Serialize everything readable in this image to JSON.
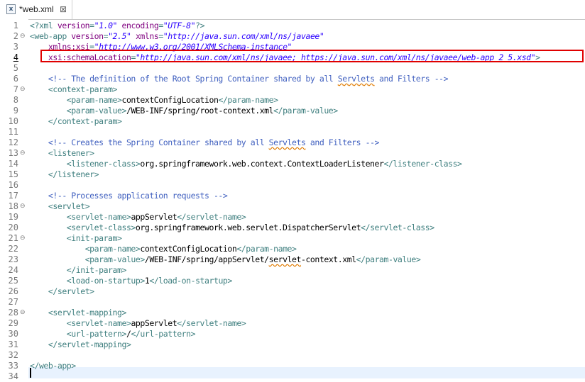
{
  "tab": {
    "icon": "xml-file-icon",
    "title": "*web.xml",
    "close": "⊠"
  },
  "lines": [
    {
      "n": "1",
      "fold": "",
      "parts": [
        [
          "t",
          "<?xml "
        ],
        [
          "a",
          "version"
        ],
        [
          "t",
          "="
        ],
        [
          "v",
          "\"1.0\""
        ],
        [
          "t",
          " "
        ],
        [
          "a",
          "encoding"
        ],
        [
          "t",
          "="
        ],
        [
          "v",
          "\"UTF-8\""
        ],
        [
          "t",
          "?>"
        ]
      ]
    },
    {
      "n": "2",
      "fold": "⊖",
      "parts": [
        [
          "t",
          "<web-app "
        ],
        [
          "a",
          "version"
        ],
        [
          "t",
          "="
        ],
        [
          "v",
          "\"2.5\""
        ],
        [
          "t",
          " "
        ],
        [
          "a",
          "xmlns"
        ],
        [
          "t",
          "="
        ],
        [
          "v",
          "\"http://java.sun.com/xml/ns/javaee\""
        ]
      ]
    },
    {
      "n": "3",
      "fold": "",
      "parts": [
        [
          "x",
          "    "
        ],
        [
          "a",
          "xmlns:xsi"
        ],
        [
          "t",
          "="
        ],
        [
          "v",
          "\"http://www.w3.org/2001/XMLSchema-instance\""
        ]
      ]
    },
    {
      "n": "4",
      "fold": "",
      "parts": [
        [
          "x",
          "    "
        ],
        [
          "a",
          "xsi:schemaLocation"
        ],
        [
          "t",
          "="
        ],
        [
          "v",
          "\"http://java.sun.com/xml/ns/javaee; https://java.sun.com/xml/ns/javaee/web-app_2_5.xsd\""
        ],
        [
          "t",
          ">"
        ]
      ]
    },
    {
      "n": "5",
      "fold": "",
      "parts": []
    },
    {
      "n": "6",
      "fold": "",
      "parts": [
        [
          "x",
          "    "
        ],
        [
          "c",
          "<!-- The definition of the Root Spring Container shared by all "
        ],
        [
          "cu",
          "Servlets"
        ],
        [
          "c",
          " and Filters -->"
        ]
      ]
    },
    {
      "n": "7",
      "fold": "⊖",
      "parts": [
        [
          "x",
          "    "
        ],
        [
          "t",
          "<context-param>"
        ]
      ]
    },
    {
      "n": "8",
      "fold": "",
      "parts": [
        [
          "x",
          "        "
        ],
        [
          "t",
          "<param-name>"
        ],
        [
          "x",
          "contextConfigLocation"
        ],
        [
          "t",
          "</param-name>"
        ]
      ]
    },
    {
      "n": "9",
      "fold": "",
      "parts": [
        [
          "x",
          "        "
        ],
        [
          "t",
          "<param-value>"
        ],
        [
          "x",
          "/WEB-INF/spring/root-context.xml"
        ],
        [
          "t",
          "</param-value>"
        ]
      ]
    },
    {
      "n": "10",
      "fold": "",
      "parts": [
        [
          "x",
          "    "
        ],
        [
          "t",
          "</context-param>"
        ]
      ]
    },
    {
      "n": "11",
      "fold": "",
      "parts": []
    },
    {
      "n": "12",
      "fold": "",
      "parts": [
        [
          "x",
          "    "
        ],
        [
          "c",
          "<!-- Creates the Spring Container shared by all "
        ],
        [
          "cu",
          "Servlets"
        ],
        [
          "c",
          " and Filters -->"
        ]
      ]
    },
    {
      "n": "13",
      "fold": "⊖",
      "parts": [
        [
          "x",
          "    "
        ],
        [
          "t",
          "<listener>"
        ]
      ]
    },
    {
      "n": "14",
      "fold": "",
      "parts": [
        [
          "x",
          "        "
        ],
        [
          "t",
          "<listener-class>"
        ],
        [
          "x",
          "org.springframework.web.context.ContextLoaderListener"
        ],
        [
          "t",
          "</listener-class>"
        ]
      ]
    },
    {
      "n": "15",
      "fold": "",
      "parts": [
        [
          "x",
          "    "
        ],
        [
          "t",
          "</listener>"
        ]
      ]
    },
    {
      "n": "16",
      "fold": "",
      "parts": []
    },
    {
      "n": "17",
      "fold": "",
      "parts": [
        [
          "x",
          "    "
        ],
        [
          "c",
          "<!-- Processes application requests -->"
        ]
      ]
    },
    {
      "n": "18",
      "fold": "⊖",
      "parts": [
        [
          "x",
          "    "
        ],
        [
          "t",
          "<servlet>"
        ]
      ]
    },
    {
      "n": "19",
      "fold": "",
      "parts": [
        [
          "x",
          "        "
        ],
        [
          "t",
          "<servlet-name>"
        ],
        [
          "x",
          "appServlet"
        ],
        [
          "t",
          "</servlet-name>"
        ]
      ]
    },
    {
      "n": "20",
      "fold": "",
      "parts": [
        [
          "x",
          "        "
        ],
        [
          "t",
          "<servlet-class>"
        ],
        [
          "x",
          "org.springframework.web.servlet.DispatcherServlet"
        ],
        [
          "t",
          "</servlet-class>"
        ]
      ]
    },
    {
      "n": "21",
      "fold": "⊖",
      "parts": [
        [
          "x",
          "        "
        ],
        [
          "t",
          "<init-param>"
        ]
      ]
    },
    {
      "n": "22",
      "fold": "",
      "parts": [
        [
          "x",
          "            "
        ],
        [
          "t",
          "<param-name>"
        ],
        [
          "x",
          "contextConfigLocation"
        ],
        [
          "t",
          "</param-name>"
        ]
      ]
    },
    {
      "n": "23",
      "fold": "",
      "parts": [
        [
          "x",
          "            "
        ],
        [
          "t",
          "<param-value>"
        ],
        [
          "x",
          "/WEB-INF/spring/appServlet/"
        ],
        [
          "xu",
          "servlet"
        ],
        [
          "x",
          "-context.xml"
        ],
        [
          "t",
          "</param-value>"
        ]
      ]
    },
    {
      "n": "24",
      "fold": "",
      "parts": [
        [
          "x",
          "        "
        ],
        [
          "t",
          "</init-param>"
        ]
      ]
    },
    {
      "n": "25",
      "fold": "",
      "parts": [
        [
          "x",
          "        "
        ],
        [
          "t",
          "<load-on-startup>"
        ],
        [
          "x",
          "1"
        ],
        [
          "t",
          "</load-on-startup>"
        ]
      ]
    },
    {
      "n": "26",
      "fold": "",
      "parts": [
        [
          "x",
          "    "
        ],
        [
          "t",
          "</servlet>"
        ]
      ]
    },
    {
      "n": "27",
      "fold": "",
      "parts": []
    },
    {
      "n": "28",
      "fold": "⊖",
      "parts": [
        [
          "x",
          "    "
        ],
        [
          "t",
          "<servlet-mapping>"
        ]
      ]
    },
    {
      "n": "29",
      "fold": "",
      "parts": [
        [
          "x",
          "        "
        ],
        [
          "t",
          "<servlet-name>"
        ],
        [
          "x",
          "appServlet"
        ],
        [
          "t",
          "</servlet-name>"
        ]
      ]
    },
    {
      "n": "30",
      "fold": "",
      "parts": [
        [
          "x",
          "        "
        ],
        [
          "t",
          "<url-pattern>"
        ],
        [
          "x",
          "/"
        ],
        [
          "t",
          "</url-pattern>"
        ]
      ]
    },
    {
      "n": "31",
      "fold": "",
      "parts": [
        [
          "x",
          "    "
        ],
        [
          "t",
          "</servlet-mapping>"
        ]
      ]
    },
    {
      "n": "32",
      "fold": "",
      "parts": []
    },
    {
      "n": "33",
      "fold": "",
      "parts": [
        [
          "t",
          "</web-app>"
        ]
      ]
    },
    {
      "n": "34",
      "fold": "",
      "parts": []
    }
  ],
  "highlight_line": "4",
  "colors": {
    "tag": "#3f7f7f",
    "attr": "#7f007f",
    "value": "#2a00ff",
    "comment": "#3f5fbf",
    "highlight": "#e00000"
  }
}
